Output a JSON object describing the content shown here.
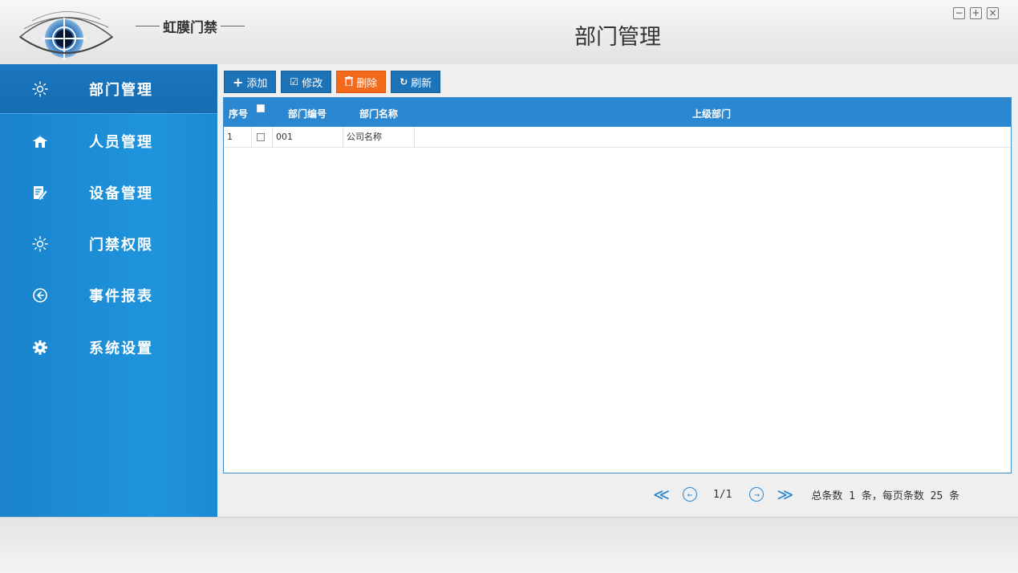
{
  "header": {
    "brand": "虹膜门禁",
    "title": "部门管理"
  },
  "window_controls": {
    "minimize": "−",
    "maximize": "+",
    "close": "×"
  },
  "sidebar": {
    "items": [
      {
        "label": "部门管理",
        "icon": "sun-icon",
        "active": true
      },
      {
        "label": "人员管理",
        "icon": "home-icon",
        "active": false
      },
      {
        "label": "设备管理",
        "icon": "edit-icon",
        "active": false
      },
      {
        "label": "门禁权限",
        "icon": "sun-icon",
        "active": false
      },
      {
        "label": "事件报表",
        "icon": "arrow-left-circle-icon",
        "active": false
      },
      {
        "label": "系统设置",
        "icon": "gear-icon",
        "active": false
      }
    ]
  },
  "toolbar": {
    "add": "添加",
    "edit": "修改",
    "delete": "删除",
    "refresh": "刷新"
  },
  "table": {
    "columns": [
      "序号",
      "部门编号",
      "部门名称",
      "上级部门"
    ],
    "rows": [
      {
        "index": "1",
        "code": "001",
        "name": "公司名称",
        "parent": ""
      }
    ]
  },
  "pager": {
    "page": "1/1",
    "summary": "总条数 1 条，每页条数 25 条"
  },
  "colors": {
    "sidebar": "#1e94dc",
    "toolbar_button": "#1c73b8",
    "delete_button": "#f46a1c",
    "grid_header": "#2b87d0"
  }
}
